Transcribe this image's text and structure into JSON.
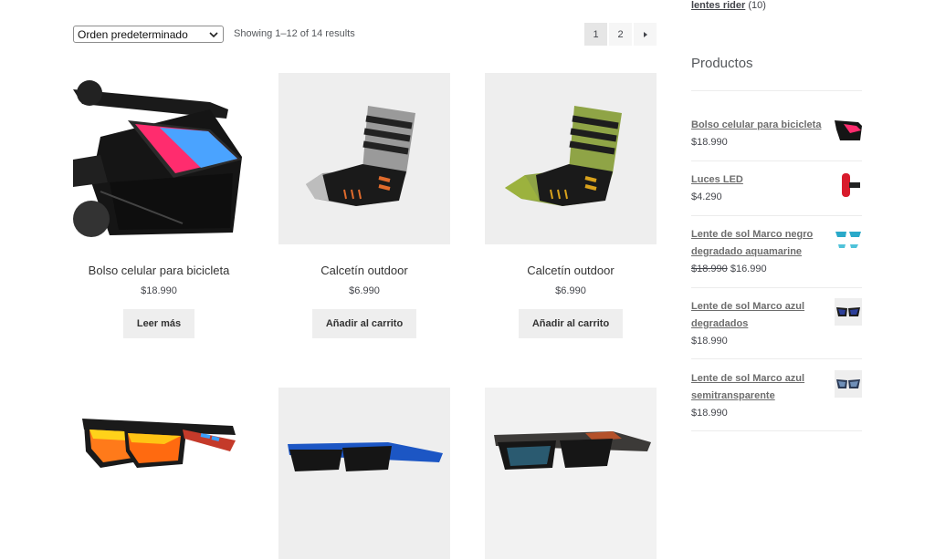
{
  "toolbar": {
    "sort_selected": "Orden predeterminado",
    "result_count": "Showing 1–12 of 14 results",
    "pages": [
      "1",
      "2"
    ],
    "next_glyph": "›"
  },
  "products": [
    {
      "name": "Bolso celular para bicicleta",
      "price": "$18.990",
      "button": "Leer más",
      "image": "bike-phone-bag"
    },
    {
      "name": "Calcetín outdoor",
      "price": "$6.990",
      "button": "Añadir al carrito",
      "image": "grey-sock"
    },
    {
      "name": "Calcetín outdoor",
      "price": "$6.990",
      "button": "Añadir al carrito",
      "image": "green-sock"
    },
    {
      "name": "",
      "price": "",
      "button": "",
      "image": "orange-lens-sunglasses"
    },
    {
      "name": "",
      "price": "",
      "button": "",
      "image": "blue-sunglasses"
    },
    {
      "name": "",
      "price": "",
      "button": "",
      "image": "dark-sunglasses"
    }
  ],
  "sidebar": {
    "top_link": "lentes rider",
    "top_count": "(10)",
    "widget_title": "Productos",
    "items": [
      {
        "name": "Bolso celular para bicicleta",
        "price": "$18.990",
        "old_price": ""
      },
      {
        "name": "Luces LED",
        "price": "$4.290",
        "old_price": ""
      },
      {
        "name": "Lente de sol Marco negro degradado aquamarine",
        "price": "$16.990",
        "old_price": "$18.990"
      },
      {
        "name": "Lente de sol Marco azul degradados",
        "price": "$18.990",
        "old_price": ""
      },
      {
        "name": "Lente de sol Marco azul semitransparente",
        "price": "$18.990",
        "old_price": ""
      }
    ]
  },
  "colors": {
    "accent_bg": "#eeeeee",
    "text": "#43454b",
    "link": "#6d6d6d"
  }
}
